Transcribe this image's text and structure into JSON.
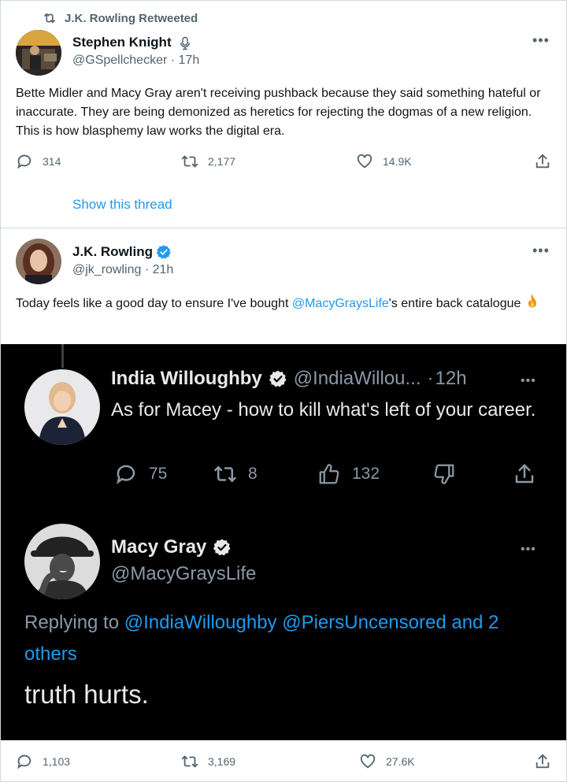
{
  "retweet_banner": {
    "text": "J.K. Rowling Retweeted",
    "icon": "retweet-icon"
  },
  "tweet1": {
    "name": "Stephen Knight",
    "name_icon": "microphone-icon",
    "handle": "@GSpellchecker",
    "time": "17h",
    "text": "Bette Midler and Macy Gray aren't receiving pushback because they said something hateful or inaccurate. They are being demonized as heretics for rejecting the dogmas of a new religion. This is how blasphemy law works the digital era.",
    "replies": "314",
    "retweets": "2,177",
    "likes": "14.9K",
    "show_thread": "Show this thread"
  },
  "tweet2": {
    "name": "J.K. Rowling",
    "handle": "@jk_rowling",
    "time": "21h",
    "text_before": "Today feels like a good day to ensure I've bought ",
    "mention": "@MacyGraysLife",
    "text_after": "'s entire back catalogue",
    "emoji_icon": "fire-icon",
    "replies": "1,103",
    "retweets": "3,169",
    "likes": "27.6K"
  },
  "embed": {
    "reply1": {
      "name": "India Willoughby",
      "handle": "@IndiaWillou...",
      "time": "12h",
      "text": "As for Macey - how to kill what's left of your career.",
      "replies": "75",
      "retweets": "8",
      "likes": "132"
    },
    "reply2": {
      "name": "Macy Gray",
      "handle": "@MacyGraysLife",
      "replying_to_prefix": "Replying to ",
      "replying_to_1": "@IndiaWilloughby",
      "replying_to_2": "@PiersUncensored",
      "replying_to_3": "and 2 others",
      "text": "truth hurts."
    }
  },
  "colors": {
    "accent": "#1d9bf0",
    "text": "#0f1419",
    "muted": "#536471",
    "embed_bg": "#000000"
  }
}
